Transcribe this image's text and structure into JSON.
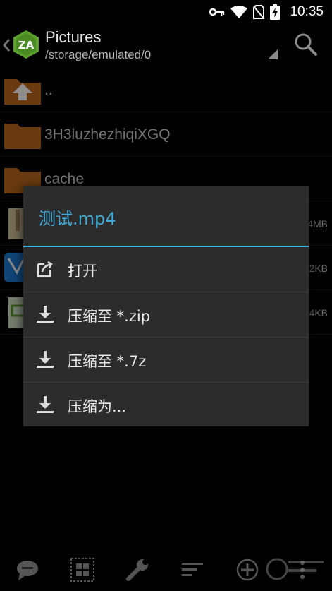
{
  "status": {
    "time": "10:35"
  },
  "header": {
    "title": "Pictures",
    "path": "/storage/emulated/0"
  },
  "files": [
    {
      "name": "..",
      "size": ""
    },
    {
      "name": "3H3luzhezhiqiXGQ",
      "size": ""
    },
    {
      "name": "cache",
      "size": ""
    },
    {
      "name": "",
      "size": "4MB"
    },
    {
      "name": "",
      "size": "2KB"
    },
    {
      "name": "",
      "size": "4KB"
    }
  ],
  "dialog": {
    "title": "测试.mp4",
    "items": [
      {
        "label": "打开",
        "icon": "open-external-icon"
      },
      {
        "label": "压缩至 *.zip",
        "icon": "download-icon"
      },
      {
        "label": "压缩至 *.7z",
        "icon": "download-icon"
      },
      {
        "label": "压缩为...",
        "icon": "download-icon"
      }
    ]
  },
  "colors": {
    "accent": "#33b5e5",
    "dialog_bg": "#2c2c2c",
    "folder": "#c06a1e",
    "logo": "#5aa02c"
  }
}
